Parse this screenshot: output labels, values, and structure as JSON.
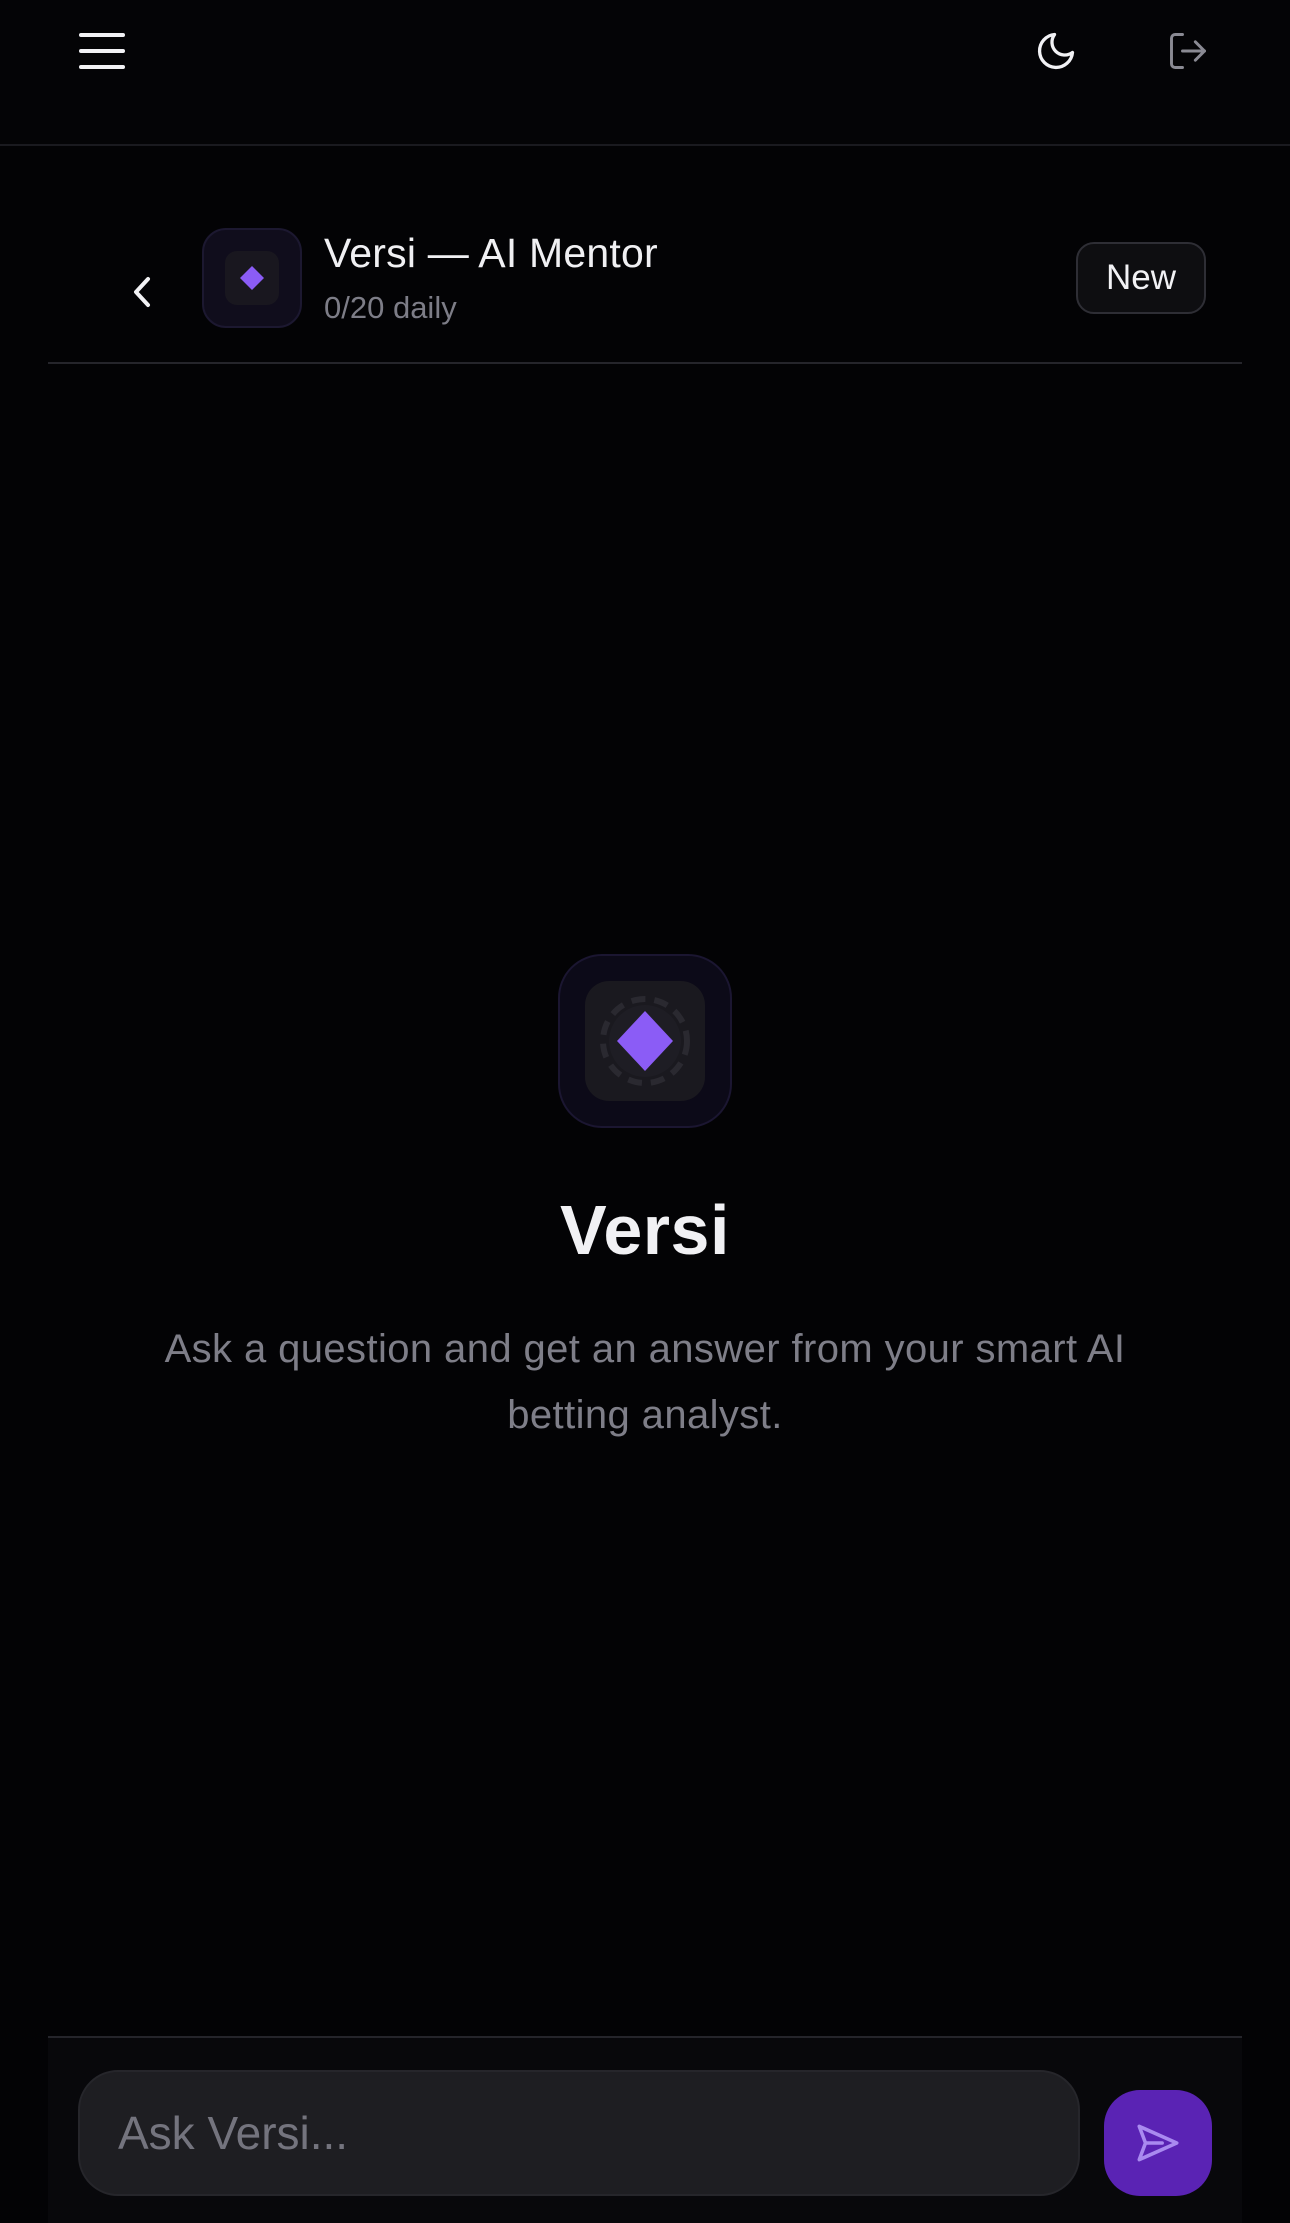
{
  "topbar": {
    "menu_icon": "hamburger-menu-icon",
    "theme_icon": "moon-icon",
    "logout_icon": "logout-icon"
  },
  "chat_header": {
    "back_icon": "chevron-left-icon",
    "avatar_icon": "diamond-icon",
    "title": "Versi — AI Mentor",
    "subtitle": "0/20 daily",
    "new_label": "New"
  },
  "empty_state": {
    "avatar_icon": "diamond-icon",
    "title": "Versi",
    "description": "Ask a question and get an answer from your smart AI betting analyst."
  },
  "composer": {
    "placeholder": "Ask Versi...",
    "value": "",
    "send_icon": "send-icon"
  },
  "colors": {
    "background": "#030305",
    "accent": "#8b5cf6",
    "send_button": "#5a23b4",
    "muted_text": "#7e7e88"
  }
}
